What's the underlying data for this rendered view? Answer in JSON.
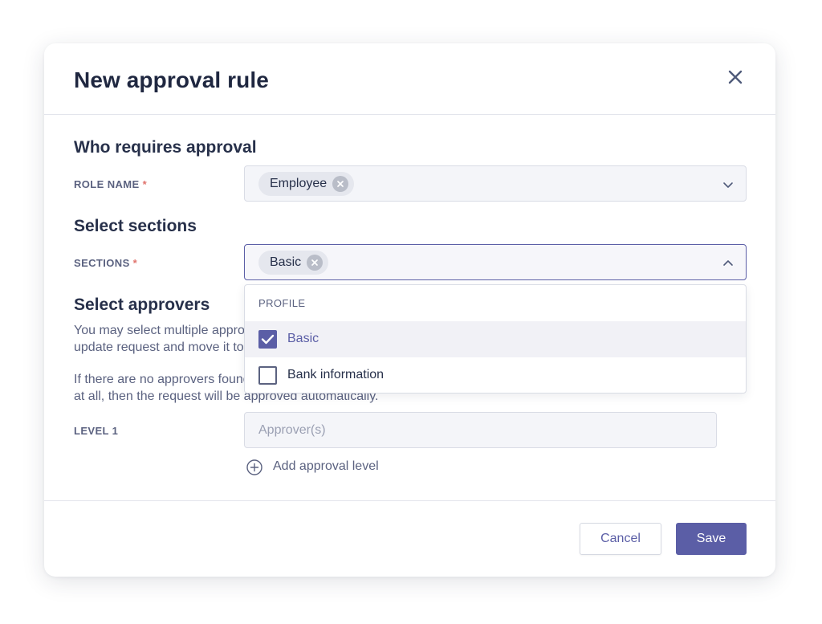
{
  "modal": {
    "title": "New approval rule"
  },
  "who": {
    "heading": "Who requires approval",
    "role_label": "ROLE NAME",
    "required_marker": "*",
    "role_chip": "Employee"
  },
  "sections": {
    "heading": "Select sections",
    "label": "SECTIONS",
    "required_marker": "*",
    "chip": "Basic",
    "dropdown": {
      "group": "PROFILE",
      "options": [
        {
          "label": "Basic",
          "checked": true
        },
        {
          "label": "Bank information",
          "checked": false
        }
      ]
    }
  },
  "approvers": {
    "heading": "Select approvers",
    "desc1_line1": "You may select multiple approv",
    "desc1_line2": "update request and move it to",
    "desc2_line1": "If there are no approvers found",
    "desc2_line2": "at all, then the request will be approved automatically.",
    "level_label": "LEVEL 1",
    "input_placeholder": "Approver(s)",
    "add_level": "Add approval level"
  },
  "footer": {
    "cancel": "Cancel",
    "save": "Save"
  },
  "colors": {
    "accent": "#5b5ea6",
    "required": "#e0736d",
    "text_dark": "#1f2740",
    "text_muted": "#5b6280"
  },
  "icons": {
    "close": "close-icon",
    "chip_remove": "x-circle-icon",
    "chevron_down": "chevron-down-icon",
    "chevron_up": "chevron-up-icon",
    "checkmark": "check-icon",
    "add": "plus-circle-icon"
  }
}
